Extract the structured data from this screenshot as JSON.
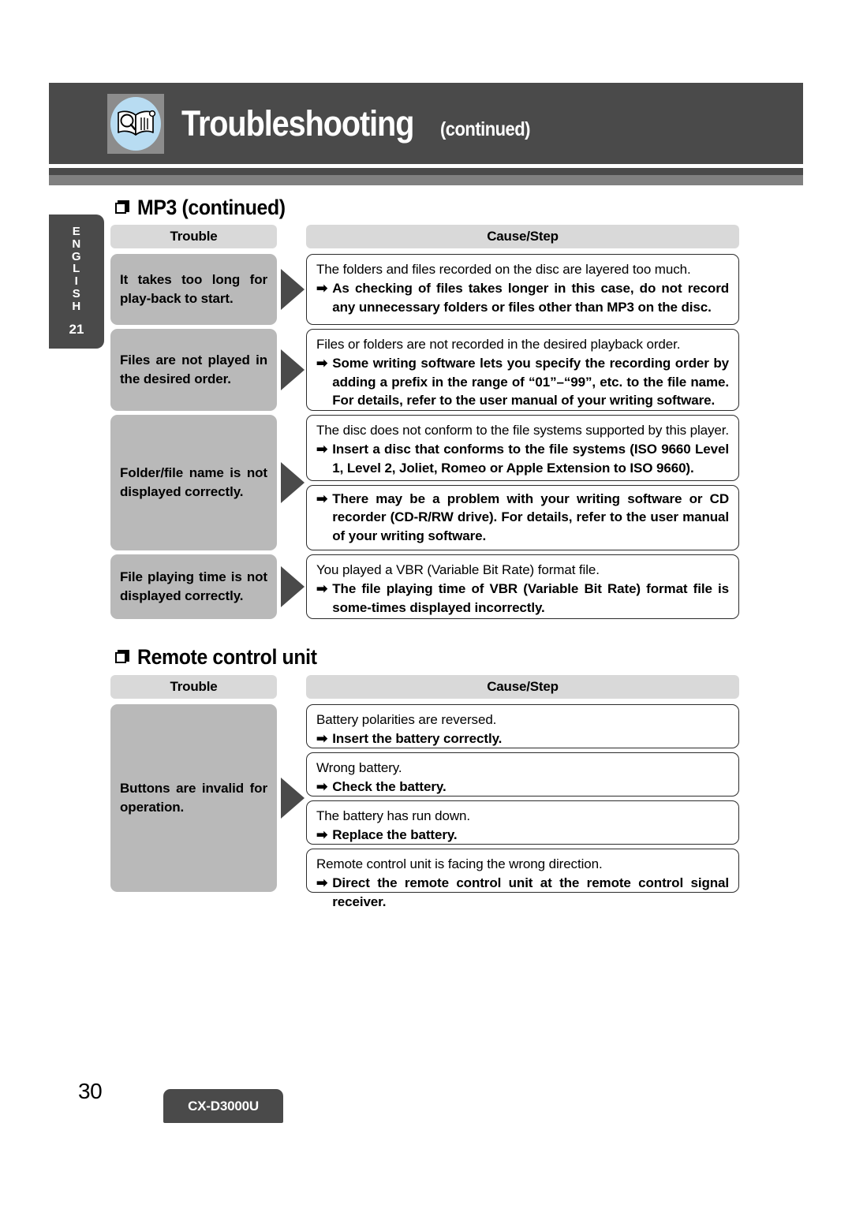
{
  "header": {
    "title": "Troubleshooting",
    "subtitle": "(continued)",
    "icon": "book-magnifier-icon"
  },
  "side_tab": {
    "language_letters": [
      "E",
      "N",
      "G",
      "L",
      "I",
      "S",
      "H"
    ],
    "page_marker": "21"
  },
  "sections": [
    {
      "heading": "MP3 (continued)",
      "columns": {
        "trouble": "Trouble",
        "cause": "Cause/Step"
      },
      "rows": [
        {
          "trouble": "It takes too long for play-back to start.",
          "boxes": [
            {
              "cause": "The folders and files recorded on the disc are layered too much.",
              "arrow": "➡",
              "step": "As checking of files takes longer in this case, do not record any unnecessary folders or files other than MP3 on the disc."
            }
          ]
        },
        {
          "trouble": "Files are not played in the desired order.",
          "boxes": [
            {
              "cause": "Files or folders are not recorded in the desired playback order.",
              "arrow": "➡",
              "step": "Some writing software lets you specify the recording order by adding a prefix in the range of “01”–“99”, etc. to the file name. For details, refer to the user manual of your writing software."
            }
          ]
        },
        {
          "trouble": "Folder/file name is not displayed correctly.",
          "boxes": [
            {
              "cause": "The disc does not conform to the file systems supported by this player.",
              "arrow": "➡",
              "step": "Insert a disc that conforms to the file systems (ISO 9660 Level 1, Level 2, Joliet, Romeo or Apple Extension to ISO 9660)."
            },
            {
              "cause": "",
              "arrow": "➡",
              "step": "There may be a problem with your writing software or CD recorder (CD-R/RW drive). For details, refer to the user manual of your writing software."
            }
          ]
        },
        {
          "trouble": "File playing time is not displayed correctly.",
          "boxes": [
            {
              "cause": "You played a VBR (Variable Bit Rate) format  file.",
              "arrow": "➡",
              "step": "The file playing time of VBR (Variable Bit Rate) format file is some-times displayed incorrectly."
            }
          ]
        }
      ]
    },
    {
      "heading": "Remote control unit",
      "columns": {
        "trouble": "Trouble",
        "cause": "Cause/Step"
      },
      "rows": [
        {
          "trouble": "Buttons are invalid for operation.",
          "boxes": [
            {
              "cause": "Battery polarities are reversed.",
              "arrow": "➡",
              "step": "Insert the battery correctly."
            },
            {
              "cause": "Wrong battery.",
              "arrow": "➡",
              "step": "Check the battery."
            },
            {
              "cause": "The battery has run down.",
              "arrow": "➡",
              "step": "Replace the battery."
            },
            {
              "cause": "Remote control unit is facing the wrong direction.",
              "arrow": "➡",
              "step": "Direct the remote control unit at the remote control signal receiver."
            }
          ]
        }
      ]
    }
  ],
  "footer": {
    "page_number": "30",
    "model": "CX-D3000U"
  },
  "colors": {
    "header_bar": "#4a4a4a",
    "rule_mid": "#808080",
    "col_head": "#d9d9d9",
    "trouble_cell": "#b9b9b9",
    "icon_circle": "#b8dcf2"
  }
}
